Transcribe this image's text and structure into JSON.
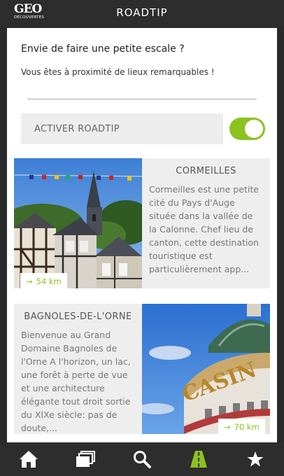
{
  "header": {
    "logo_geo": "GEO",
    "logo_sub": "DÉCOUVERTES",
    "title": "ROADTIP"
  },
  "intro": {
    "heading": "Envie de faire une petite escale ?",
    "subtitle": "Vous êtes à proximité de lieux remarquables !"
  },
  "activate": {
    "label": "ACTIVER ROADTIP",
    "enabled": true
  },
  "places": [
    {
      "title": "CORMEILLES",
      "description": "Cormeilles est une petite cité du Pays d'Auge située dans la vallée de la Calonne. Chef lieu de canton, cette destination touristique est particulièrement app...",
      "distance": "54 km",
      "image": "half-timbered-village-church"
    },
    {
      "title": "BAGNOLES-DE-L'ORNE",
      "description": "Bienvenue au Grand Domaine Bagnoles de l'Orne A l'horizon, un lac, une forêt à perte de vue et une architecture élégante tout droit sortie du XIXe siècle: pas de doute,...",
      "distance": "70 km",
      "image": "casino-building"
    }
  ],
  "nav": [
    {
      "icon": "home-icon"
    },
    {
      "icon": "stack-icon"
    },
    {
      "icon": "search-icon"
    },
    {
      "icon": "road-icon",
      "active": true
    },
    {
      "icon": "star-icon"
    }
  ],
  "colors": {
    "accent": "#8cc21f",
    "bar": "#2d2d2d",
    "card_bg": "#eeeeee"
  }
}
